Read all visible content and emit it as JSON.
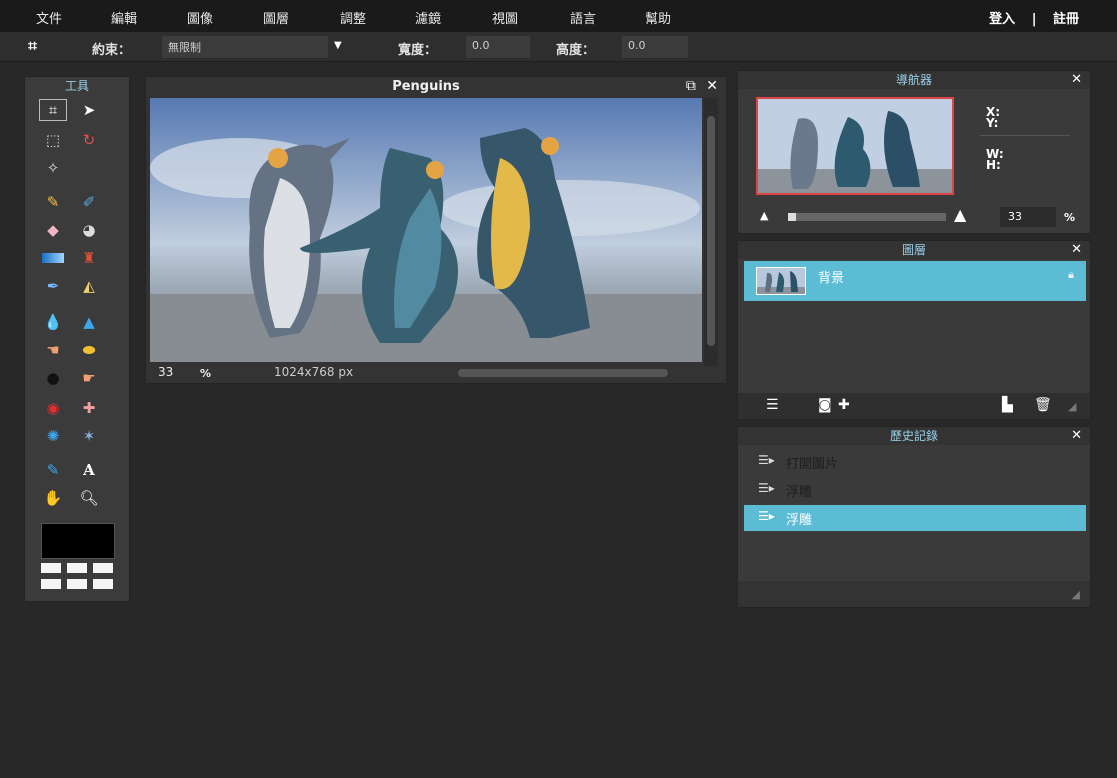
{
  "menu": [
    "文件",
    "編輯",
    "圖像",
    "圖層",
    "調整",
    "濾鏡",
    "視圖",
    "語言",
    "幫助"
  ],
  "auth": {
    "login": "登入",
    "separator": "|",
    "register": "註冊"
  },
  "options": {
    "constraint_label": "約束：",
    "constraint_value": "無限制",
    "width_label": "寬度：",
    "width_value": "0.0",
    "height_label": "高度：",
    "height_value": "0.0"
  },
  "tools": {
    "title": "工具"
  },
  "document": {
    "title": "Penguins",
    "zoom": "33",
    "zoom_unit": "%",
    "dimensions": "1024x768 px"
  },
  "navigator": {
    "title": "導航器",
    "x_label": "X:",
    "y_label": "Y:",
    "w_label": "W:",
    "h_label": "H:",
    "zoom_value": "33",
    "zoom_unit": "%",
    "zoom_fraction": 0.05
  },
  "layers": {
    "title": "圖層",
    "items": [
      {
        "name": "背景"
      }
    ]
  },
  "history": {
    "title": "歷史記錄",
    "items": [
      {
        "label": "打開圖片"
      },
      {
        "label": "浮雕"
      },
      {
        "label": "浮雕"
      }
    ]
  },
  "colors": {
    "accent": "#5bbcd4",
    "panel_bg": "#3a3a3a",
    "app_bg": "#282828",
    "menubar_bg": "#1a1a1a",
    "foreground_color": "#000000"
  }
}
